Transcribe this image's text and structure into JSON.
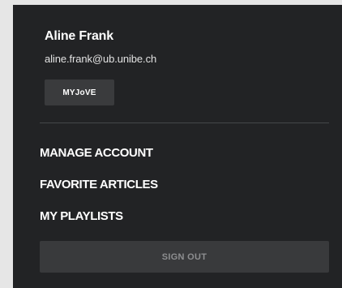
{
  "user": {
    "name": "Aline Frank",
    "email": "aline.frank@ub.unibe.ch"
  },
  "actions": {
    "myjove_label": "MYJoVE",
    "signout_label": "SIGN OUT"
  },
  "menu": {
    "items": [
      {
        "label": "MANAGE ACCOUNT"
      },
      {
        "label": "FAVORITE ARTICLES"
      },
      {
        "label": "MY PLAYLISTS"
      }
    ]
  },
  "colors": {
    "page_background": "#e6e6e6",
    "panel_background": "#222325",
    "button_background": "#393a3c",
    "divider": "#45474a",
    "text_primary": "#ffffff",
    "text_muted": "#8d8e90"
  }
}
